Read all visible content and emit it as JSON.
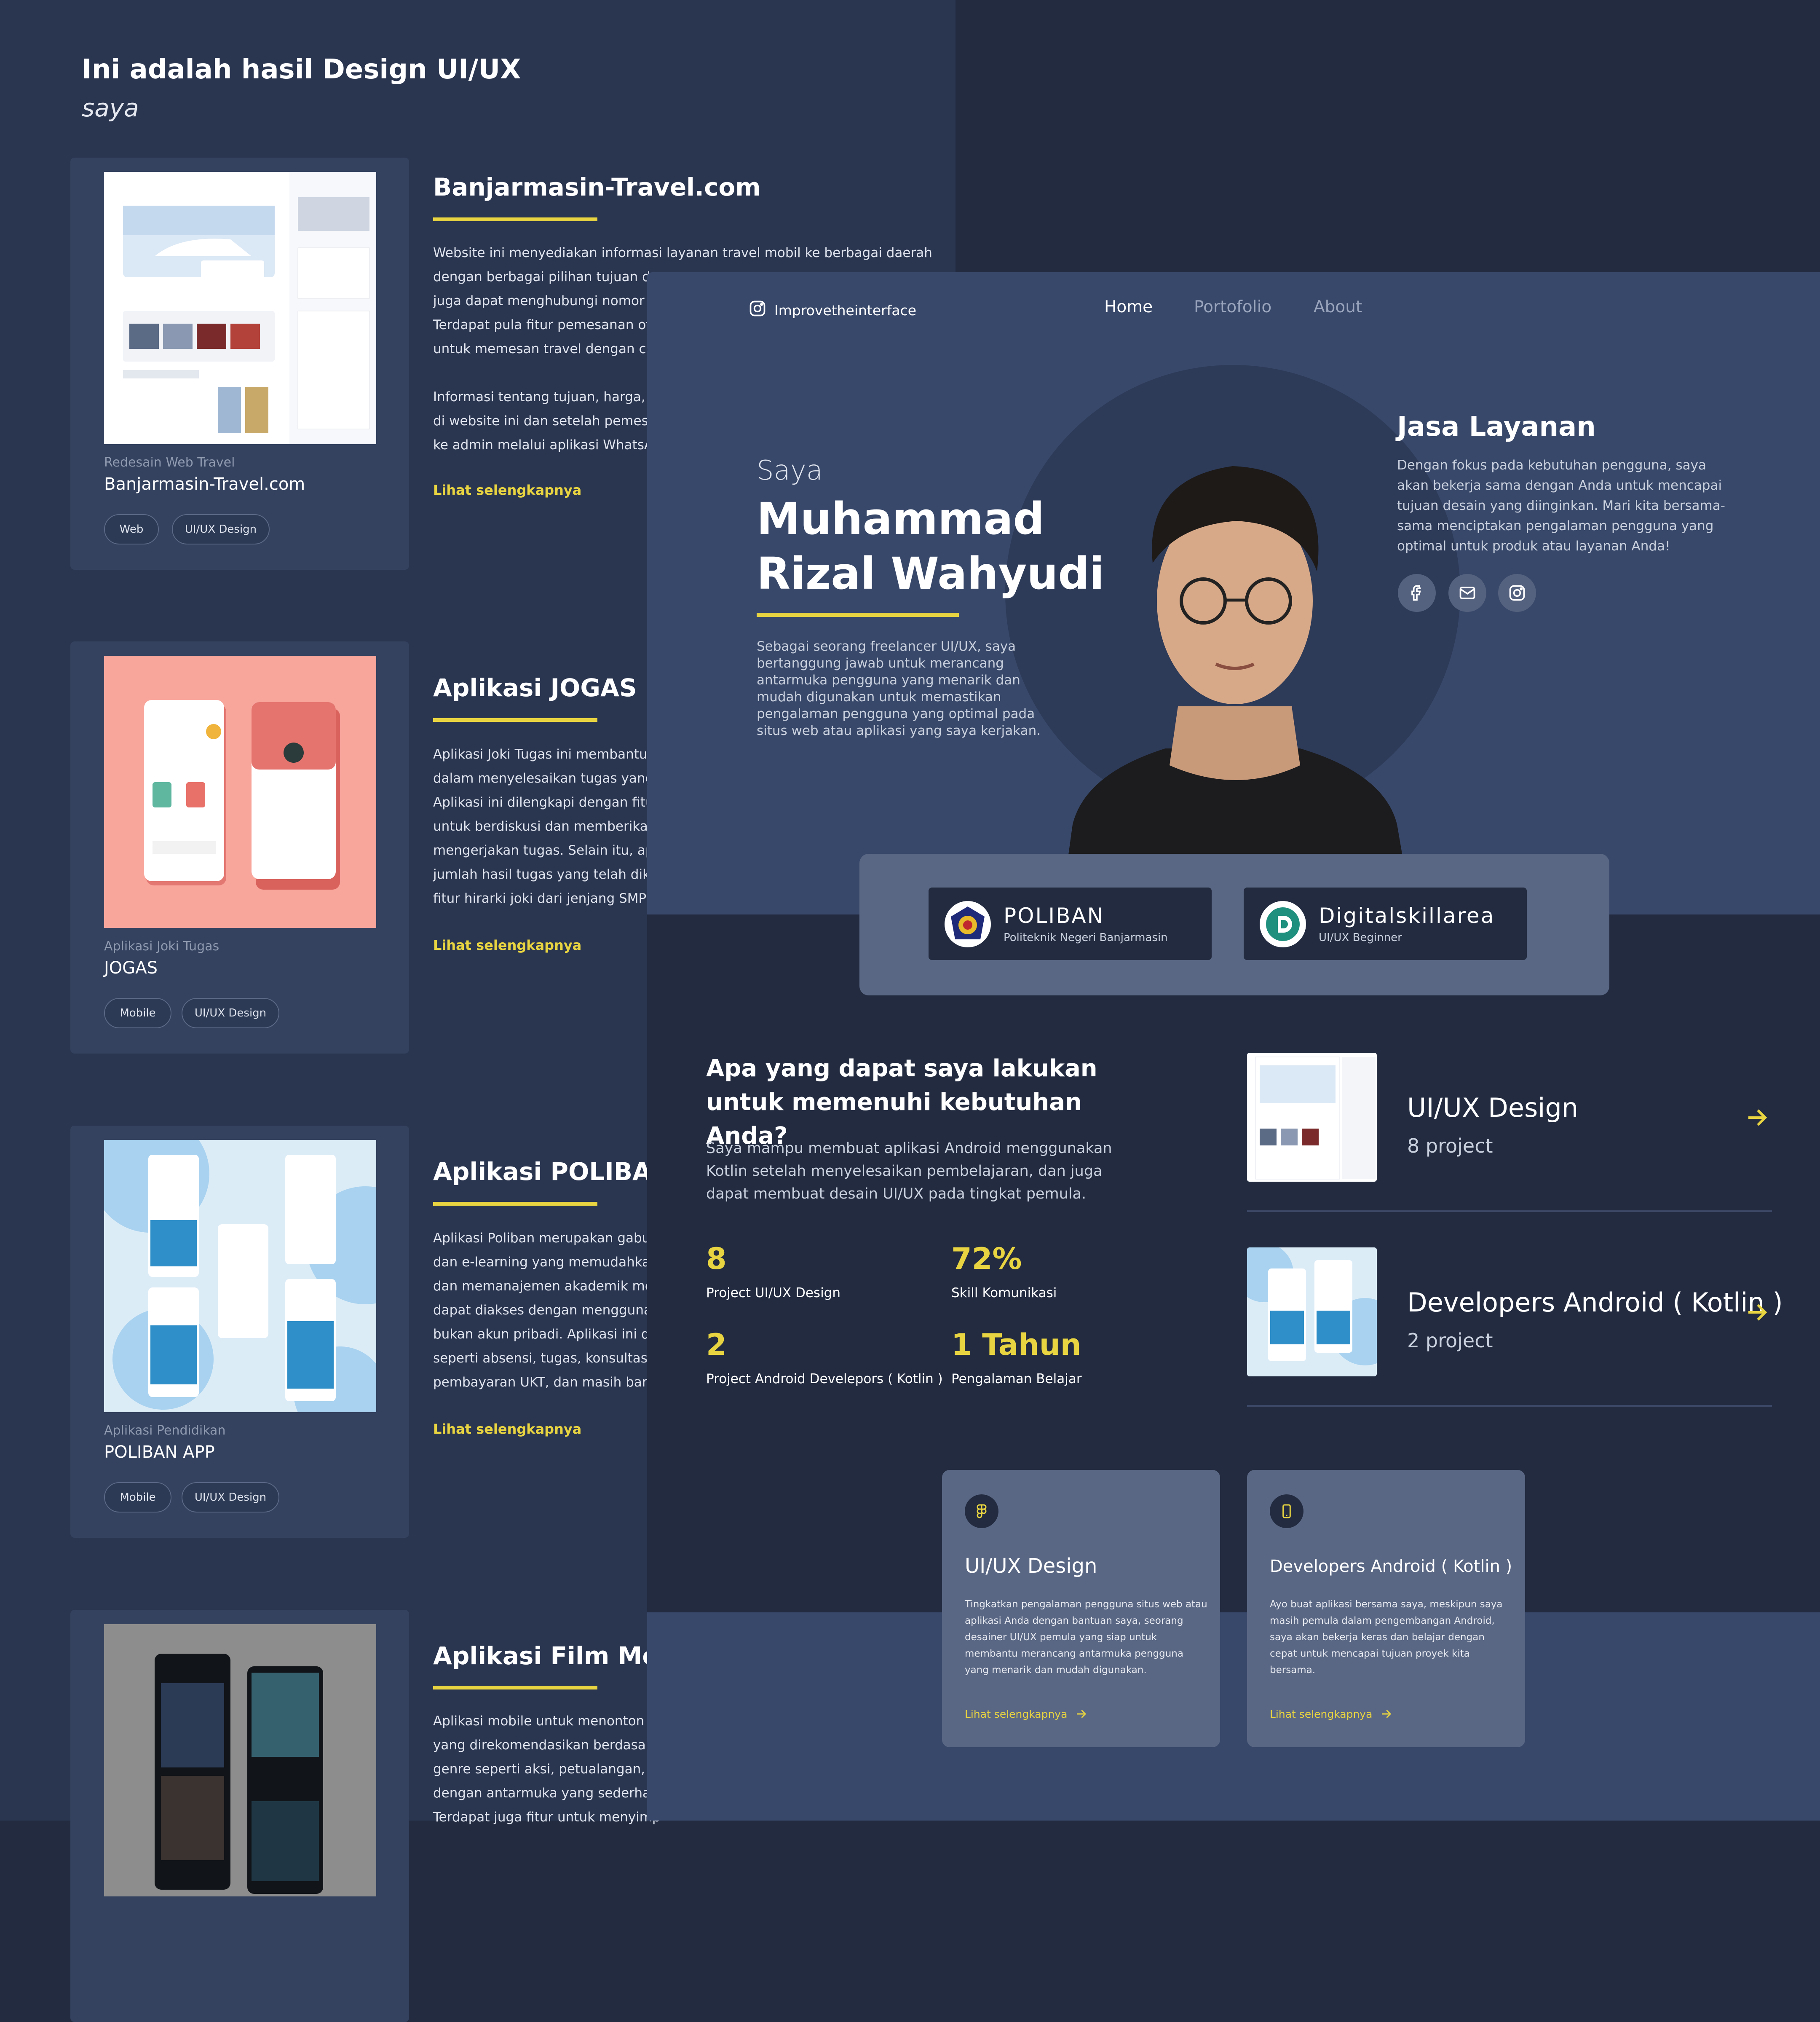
{
  "portfolio": {
    "heading": "Ini adalah hasil Design UI/UX",
    "subheading": "saya",
    "projects": [
      {
        "category": "Redesain Web Travel",
        "name": "Banjarmasin-Travel.com",
        "tags": [
          "Web",
          "UI/UX Design"
        ],
        "title": "Banjarmasin-Travel.com",
        "description": "Website ini menyediakan informasi layanan travel mobil ke berbagai daerah\ndengan berbagai pilihan tujuan dan\njuga dapat menghubungi nomor te\nTerdapat pula fitur pemesanan oto\nuntuk memesan travel dengan cep\n\nInformasi tentang tujuan, harga, da\ndi website ini dan setelah pemesan\nke admin melalui aplikasi WhatsAp",
        "more": "Lihat selengkapnya"
      },
      {
        "category": "Aplikasi Joki Tugas",
        "name": "JOGAS",
        "tags": [
          "Mobile",
          "UI/UX Design"
        ],
        "title": "Aplikasi JOGAS ( J",
        "description": "Aplikasi Joki Tugas ini membantu p\ndalam menyelesaikan tugas yang s\nAplikasi ini dilengkapi dengan fitur\nuntuk berdiskusi dan memberikan\nmengerjakan tugas. Selain itu, apli\njumlah hasil tugas yang telah diker\nfitur hirarki joki dari jenjang SMP h",
        "more": "Lihat selengkapnya"
      },
      {
        "category": "Aplikasi Pendidikan",
        "name": "POLIBAN APP",
        "tags": [
          "Mobile",
          "UI/UX Design"
        ],
        "title": "Aplikasi POLIBAN",
        "description": "Aplikasi Poliban merupakan gabun\ndan e-learning yang memudahkan\ndan memanajemen akademik mere\ndapat diakses dengan menggunak\nbukan akun pribadi. Aplikasi ini dil\nseperti absensi, tugas, konsultasi l\npembayaran UKT, dan masih bany",
        "more": "Lihat selengkapnya"
      },
      {
        "category": "",
        "name": "",
        "tags": [],
        "title": "Aplikasi Film Mobi",
        "description": "Aplikasi mobile untuk menonton fil\nyang direkomendasikan berdasark\ngenre seperti aksi, petualangan, d\ndengan antarmuka yang sederhan\nTerdapat juga fitur untuk menyimp",
        "more": ""
      }
    ]
  },
  "landing": {
    "brand": "Improvetheinterface",
    "nav": [
      "Home",
      "Portofolio",
      "About"
    ],
    "hero": {
      "greeting": "Saya",
      "name": "Muhammad Rizal Wahyudi",
      "description": "Sebagai seorang freelancer UI/UX, saya bertanggung jawab untuk merancang antarmuka pengguna yang menarik dan mudah digunakan untuk memastikan pengalaman pengguna yang optimal pada situs web atau aplikasi yang saya kerjakan."
    },
    "jasa": {
      "title": "Jasa Layanan",
      "description": "Dengan fokus pada kebutuhan pengguna, saya akan bekerja sama dengan Anda untuk mencapai tujuan desain yang diinginkan. Mari kita bersama-sama menciptakan pengalaman pengguna yang optimal untuk produk atau layanan Anda!",
      "socials": [
        "facebook-icon",
        "mail-icon",
        "instagram-icon"
      ]
    },
    "education": [
      {
        "name": "POLIBAN",
        "sub": "Politeknik Negeri Banjarmasin"
      },
      {
        "name": "Digitalskillarea",
        "sub": "UI/UX Beginner"
      }
    ],
    "services_intro": {
      "title": "Apa yang dapat saya lakukan untuk memenuhi kebutuhan Anda?",
      "description": "Saya mampu membuat aplikasi Android menggunakan Kotlin setelah menyelesaikan pembelajaran, dan juga dapat membuat desain UI/UX pada tingkat pemula."
    },
    "stats": [
      {
        "value": "8",
        "label": "Project UI/UX Design"
      },
      {
        "value": "72%",
        "label": "Skill Komunikasi"
      },
      {
        "value": "2",
        "label": "Project Android Develepors ( Kotlin )"
      },
      {
        "value": "1 Tahun",
        "label": "Pengalaman Belajar"
      }
    ],
    "service_rows": [
      {
        "title": "UI/UX Design",
        "count": "8 project"
      },
      {
        "title": "Developers Android ( Kotlin )",
        "count": "2 project"
      }
    ],
    "service_cards": [
      {
        "icon": "figma-icon",
        "title": "UI/UX Design",
        "description": "Tingkatkan pengalaman pengguna situs web atau aplikasi Anda dengan bantuan saya, seorang desainer UI/UX pemula yang siap untuk membantu merancang antarmuka pengguna yang menarik dan mudah digunakan.",
        "more": "Lihat selengkapnya"
      },
      {
        "icon": "smartphone-icon",
        "title": "Developers Android ( Kotlin )",
        "description": "Ayo buat aplikasi bersama saya, meskipun saya masih pemula dalam pengembangan Android, saya akan bekerja keras dan belajar dengan cepat untuk mencapai tujuan proyek kita bersama.",
        "more": "Lihat selengkapnya"
      }
    ],
    "colors": {
      "accent": "#e8d441",
      "bg_dark": "#222b40",
      "bg_mid": "#38486a",
      "panel": "#5a6784"
    }
  }
}
